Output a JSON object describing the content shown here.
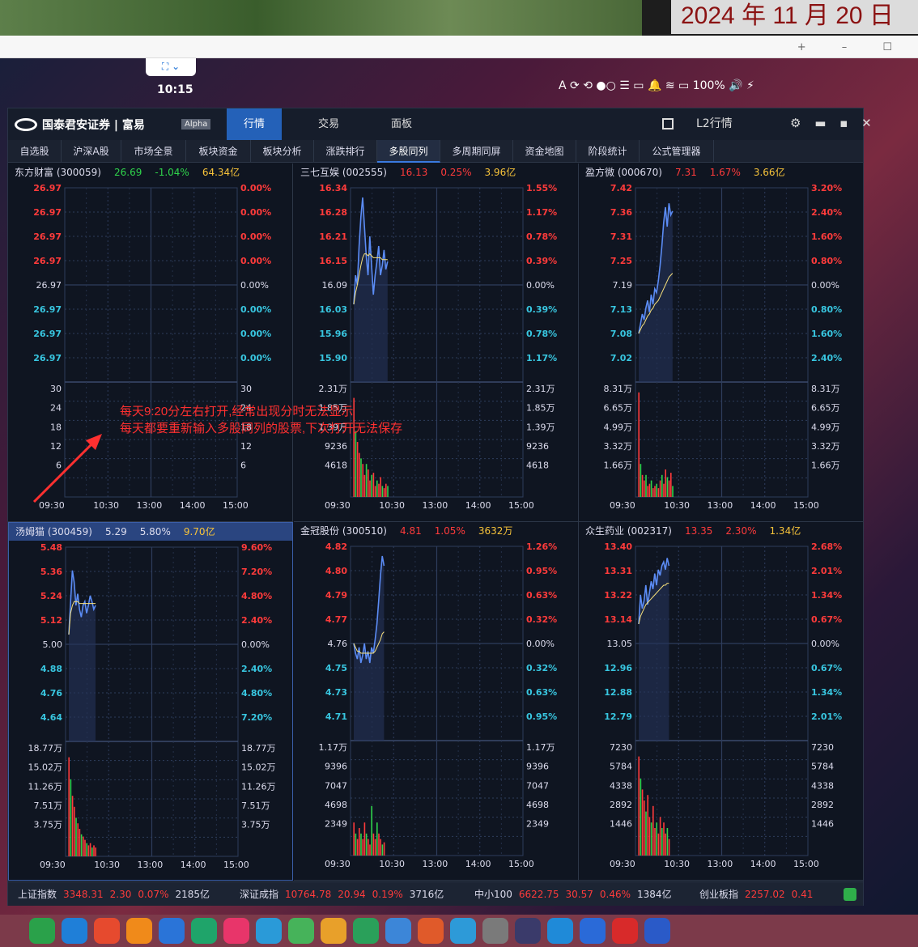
{
  "desktop": {
    "date": "2024 年 11 月 20 日",
    "clock": "10:15",
    "tray": "A  ⟳ ⟲     ●○ ☰ ▭ 🔔 ≋ ▭ 100% 🔊 ⚡",
    "float_bar": "⛶ ⌄",
    "browser_controls": "+ – ☐"
  },
  "app": {
    "logo_text": "国泰君安证券 | 富易",
    "alpha_badge": "Alpha",
    "main_tabs": [
      "行情",
      "交易",
      "面板"
    ],
    "right_title": "L2行情",
    "window_controls": "⚙ ▬ ▪ ✕",
    "sub_tabs": [
      "自选股",
      "沪深A股",
      "市场全景",
      "板块资金",
      "板块分析",
      "涨跌排行",
      "多股同列",
      "多周期同屏",
      "资金地图",
      "阶段统计",
      "公式管理器"
    ],
    "active_sub_tab": 6
  },
  "time_labels": [
    "09:30",
    "10:30",
    "13:00",
    "14:00",
    "15:00"
  ],
  "panels": [
    {
      "name": "东方财富 (300059)",
      "price": "26.69",
      "pct": "-1.04%",
      "amount": "64.34亿",
      "price_class": "dn",
      "pct_class": "dn",
      "left_axis": [
        "26.97",
        "26.97",
        "26.97",
        "26.97",
        "26.97",
        "26.97",
        "26.97",
        "26.97"
      ],
      "right_axis": [
        "0.00%",
        "0.00%",
        "0.00%",
        "0.00%",
        "0.00%",
        "0.00%",
        "0.00%",
        "0.00%"
      ],
      "vol_left": [
        "30",
        "24",
        "18",
        "12",
        "6"
      ],
      "vol_right": [
        "30",
        "24",
        "18",
        "12",
        "6"
      ],
      "line": [],
      "avg": [],
      "vol": []
    },
    {
      "name": "三七互娱 (002555)",
      "price": "16.13",
      "pct": "0.25%",
      "amount": "3.96亿",
      "price_class": "up",
      "pct_class": "up",
      "left_axis": [
        "16.34",
        "16.28",
        "16.21",
        "16.15",
        "16.09",
        "16.03",
        "15.96",
        "15.90"
      ],
      "right_axis": [
        "1.55%",
        "1.17%",
        "0.78%",
        "0.39%",
        "0.00%",
        "0.39%",
        "0.78%",
        "1.17%"
      ],
      "vol_left": [
        "2.31万",
        "1.85万",
        "1.39万",
        "9236",
        "4618"
      ],
      "vol_right": [
        "2.31万",
        "1.85万",
        "1.39万",
        "9236",
        "4618"
      ],
      "line": [
        0.4,
        0.55,
        0.5,
        0.7,
        0.85,
        0.95,
        0.8,
        0.65,
        0.55,
        0.75,
        0.6,
        0.45,
        0.55,
        0.62,
        0.7,
        0.55,
        0.6,
        0.68,
        0.58,
        0.62
      ],
      "avg": [
        0.4,
        0.46,
        0.5,
        0.55,
        0.6,
        0.64,
        0.66,
        0.66,
        0.65,
        0.66,
        0.65,
        0.64,
        0.64,
        0.64,
        0.64,
        0.64,
        0.63,
        0.63,
        0.63,
        0.63
      ],
      "vol": [
        0.9,
        0.6,
        0.5,
        0.4,
        0.35,
        0.3,
        0.2,
        0.3,
        0.25,
        0.15,
        0.2,
        0.22,
        0.1,
        0.15,
        0.12,
        0.18,
        0.1,
        0.08,
        0.12,
        0.1
      ]
    },
    {
      "name": "盈方微 (000670)",
      "price": "7.31",
      "pct": "1.67%",
      "amount": "3.66亿",
      "price_class": "up",
      "pct_class": "up",
      "left_axis": [
        "7.42",
        "7.36",
        "7.31",
        "7.25",
        "7.19",
        "7.13",
        "7.08",
        "7.02"
      ],
      "right_axis": [
        "3.20%",
        "2.40%",
        "1.60%",
        "0.80%",
        "0.00%",
        "0.80%",
        "1.60%",
        "2.40%"
      ],
      "vol_left": [
        "8.31万",
        "6.65万",
        "4.99万",
        "3.32万",
        "1.66万"
      ],
      "vol_right": [
        "8.31万",
        "6.65万",
        "4.99万",
        "3.32万",
        "1.66万"
      ],
      "line": [
        0.25,
        0.3,
        0.35,
        0.32,
        0.38,
        0.42,
        0.36,
        0.45,
        0.4,
        0.48,
        0.46,
        0.52,
        0.6,
        0.7,
        0.82,
        0.9,
        0.8,
        0.92,
        0.86,
        0.88
      ],
      "avg": [
        0.25,
        0.27,
        0.29,
        0.3,
        0.32,
        0.34,
        0.35,
        0.37,
        0.38,
        0.4,
        0.41,
        0.42,
        0.44,
        0.46,
        0.48,
        0.5,
        0.52,
        0.54,
        0.55,
        0.56
      ],
      "vol": [
        0.95,
        0.3,
        0.2,
        0.15,
        0.2,
        0.1,
        0.12,
        0.15,
        0.08,
        0.1,
        0.12,
        0.08,
        0.15,
        0.2,
        0.12,
        0.25,
        0.18,
        0.15,
        0.22,
        0.1
      ]
    },
    {
      "name": "汤姆猫 (300459)",
      "price": "5.29",
      "pct": "5.80%",
      "amount": "9.70亿",
      "price_class": "wh",
      "pct_class": "wh",
      "left_axis": [
        "5.48",
        "5.36",
        "5.24",
        "5.12",
        "5.00",
        "4.88",
        "4.76",
        "4.64"
      ],
      "right_axis": [
        "9.60%",
        "7.20%",
        "4.80%",
        "2.40%",
        "0.00%",
        "2.40%",
        "4.80%",
        "7.20%"
      ],
      "vol_left": [
        "18.77万",
        "15.02万",
        "11.26万",
        "7.51万",
        "3.75万"
      ],
      "vol_right": [
        "18.77万",
        "15.02万",
        "11.26万",
        "7.51万",
        "3.75万"
      ],
      "line": [
        0.55,
        0.72,
        0.88,
        0.82,
        0.7,
        0.76,
        0.68,
        0.64,
        0.7,
        0.72,
        0.66,
        0.7,
        0.75,
        0.72,
        0.68,
        0.7
      ],
      "avg": [
        0.55,
        0.66,
        0.7,
        0.72,
        0.72,
        0.72,
        0.71,
        0.71,
        0.71,
        0.71,
        0.71,
        0.71,
        0.71,
        0.71,
        0.71,
        0.71
      ],
      "vol": [
        0.9,
        0.7,
        0.55,
        0.45,
        0.35,
        0.3,
        0.25,
        0.2,
        0.18,
        0.15,
        0.12,
        0.1,
        0.12,
        0.08,
        0.1,
        0.08
      ]
    },
    {
      "name": "金冠股份 (300510)",
      "price": "4.81",
      "pct": "1.05%",
      "amount": "3632万",
      "price_class": "up",
      "pct_class": "up",
      "left_axis": [
        "4.82",
        "4.80",
        "4.79",
        "4.77",
        "4.76",
        "4.75",
        "4.73",
        "4.71"
      ],
      "right_axis": [
        "1.26%",
        "0.95%",
        "0.63%",
        "0.32%",
        "0.00%",
        "0.32%",
        "0.63%",
        "0.95%"
      ],
      "vol_left": [
        "1.17万",
        "9396",
        "7047",
        "4698",
        "2349"
      ],
      "vol_right": [
        "1.17万",
        "9396",
        "7047",
        "4698",
        "2349"
      ],
      "line": [
        0.5,
        0.45,
        0.42,
        0.48,
        0.4,
        0.44,
        0.5,
        0.42,
        0.46,
        0.4,
        0.48,
        0.45,
        0.52,
        0.6,
        0.72,
        0.85,
        0.95,
        0.9
      ],
      "avg": [
        0.5,
        0.48,
        0.46,
        0.46,
        0.45,
        0.45,
        0.45,
        0.45,
        0.45,
        0.45,
        0.45,
        0.45,
        0.46,
        0.48,
        0.5,
        0.52,
        0.55,
        0.56
      ],
      "vol": [
        0.3,
        0.2,
        0.15,
        0.25,
        0.2,
        0.15,
        0.3,
        0.2,
        0.15,
        0.1,
        0.45,
        0.2,
        0.15,
        0.3,
        0.2,
        0.15,
        0.1,
        0.12
      ]
    },
    {
      "name": "众生药业 (002317)",
      "price": "13.35",
      "pct": "2.30%",
      "amount": "1.34亿",
      "price_class": "up",
      "pct_class": "up",
      "left_axis": [
        "13.40",
        "13.31",
        "13.22",
        "13.14",
        "13.05",
        "12.96",
        "12.88",
        "12.79"
      ],
      "right_axis": [
        "2.68%",
        "2.01%",
        "1.34%",
        "0.67%",
        "0.00%",
        "0.67%",
        "1.34%",
        "2.01%"
      ],
      "vol_left": [
        "7230",
        "5784",
        "4338",
        "2892",
        "1446"
      ],
      "vol_right": [
        "7230",
        "5784",
        "4338",
        "2892",
        "1446"
      ],
      "line": [
        0.6,
        0.75,
        0.68,
        0.72,
        0.8,
        0.7,
        0.76,
        0.82,
        0.78,
        0.86,
        0.8,
        0.88,
        0.85,
        0.9,
        0.92,
        0.88,
        0.94,
        0.9
      ],
      "avg": [
        0.6,
        0.64,
        0.66,
        0.68,
        0.7,
        0.71,
        0.72,
        0.73,
        0.74,
        0.75,
        0.76,
        0.77,
        0.78,
        0.79,
        0.8,
        0.8,
        0.81,
        0.81
      ],
      "vol": [
        0.9,
        0.7,
        0.6,
        0.5,
        0.4,
        0.55,
        0.35,
        0.3,
        0.45,
        0.25,
        0.3,
        0.2,
        0.35,
        0.25,
        0.3,
        0.2,
        0.25,
        0.15
      ]
    }
  ],
  "status": {
    "sh_label": "上证指数",
    "sh_value": "3348.31",
    "sh_change": "2.30",
    "sh_pct": "0.07%",
    "sh_amount": "2185亿",
    "sz_label": "深证成指",
    "sz_value": "10764.78",
    "sz_change": "20.94",
    "sz_pct": "0.19%",
    "sz_amount": "3716亿",
    "zx_label": "中小100",
    "zx_value": "6622.75",
    "zx_change": "30.57",
    "zx_pct": "0.46%",
    "zx_amount": "1384亿",
    "cy_label": "创业板指",
    "cy_value": "2257.02",
    "cy_change": "0.41"
  },
  "annotation": {
    "line1": "每天9:20分左右打开,经常出现分时无法显示",
    "line2": "每天都要重新输入多股同列的股票,下次打开无法保存"
  },
  "colors": {
    "up": "#ff3b3b",
    "down": "#2fd44b",
    "flat": "#38c6e0",
    "price_line": "#5b8cf5",
    "avg_line": "#f7e07a",
    "accent": "#2461b8"
  }
}
